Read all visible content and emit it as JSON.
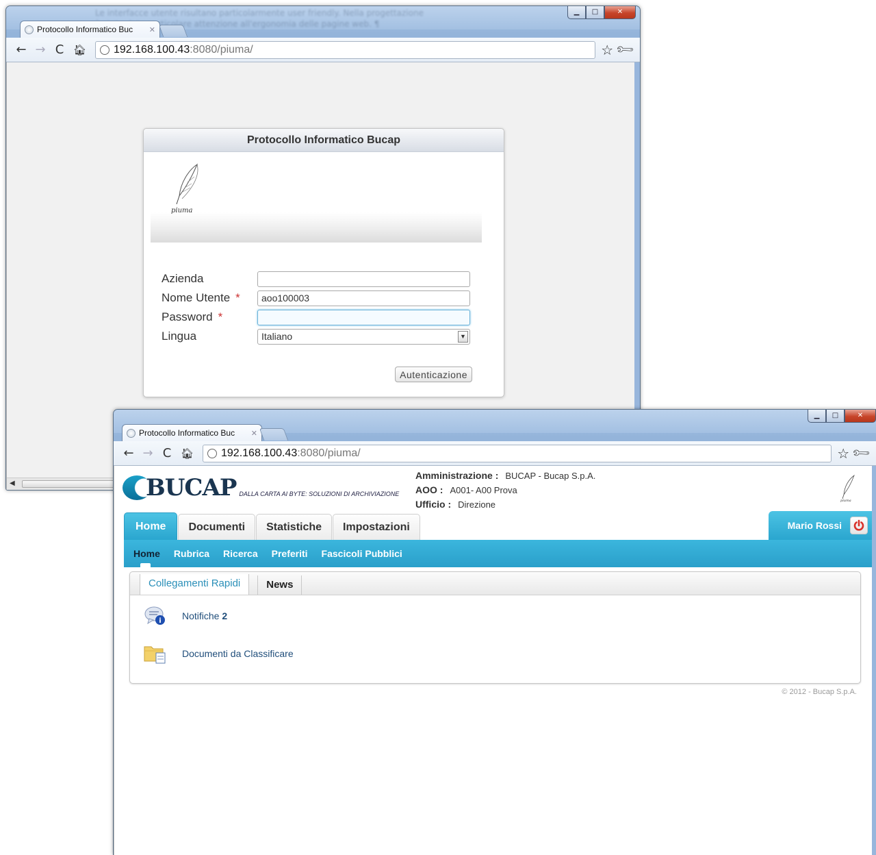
{
  "background_text": {
    "line1": "Le interfacce utente risultano particolarmente user friendly. Nella progettazione",
    "line2": "è stata data particolare attenzione all'ergonomia delle pagine web. ¶"
  },
  "login_window": {
    "tab_title": "Protocollo Informatico Buc",
    "url_host": "192.168.100.43",
    "url_path": ":8080/piuma/",
    "box_title": "Protocollo Informatico Bucap",
    "logo_text": "piuma",
    "fields": {
      "azienda_label": "Azienda",
      "azienda_value": "",
      "username_label": "Nome Utente",
      "username_value": "aoo100003",
      "password_label": "Password",
      "password_value": "",
      "lingua_label": "Lingua",
      "lingua_value": "Italiano",
      "required_mark": "*"
    },
    "submit_label": "Autenticazione"
  },
  "home_window": {
    "tab_title": "Protocollo Informatico Buc",
    "url_host": "192.168.100.43",
    "url_path": ":8080/piuma/",
    "logo_word": "BUCAP",
    "logo_tagline": "DALLA CARTA AI BYTE: SOLUZIONI DI ARCHIVIAZIONE",
    "org": {
      "amministrazione_label": "Amministrazione :",
      "amministrazione_value": "BUCAP - Bucap S.p.A.",
      "aoo_label": "AOO :",
      "aoo_value": "A001- A00 Prova",
      "ufficio_label": "Ufficio :",
      "ufficio_value": "Direzione"
    },
    "main_tabs": [
      "Home",
      "Documenti",
      "Statistiche",
      "Impostazioni"
    ],
    "user_name": "Mario Rossi",
    "sub_nav": [
      "Home",
      "Rubrica",
      "Ricerca",
      "Preferiti",
      "Fascicoli Pubblici"
    ],
    "panel_tabs": [
      "Collegamenti Rapidi",
      "News"
    ],
    "quick_links": {
      "notifiche_label": "Notifiche",
      "notifiche_count": "2",
      "documenti_label": "Documenti da Classificare"
    },
    "copyright": "© 2012 - Bucap S.p.A."
  },
  "colors": {
    "accent_blue": "#2aa6cf",
    "link_blue": "#1f4d7a",
    "required_red": "#cc3333",
    "power_red": "#d9322a"
  },
  "icons": [
    "globe-icon",
    "back-arrow-icon",
    "forward-arrow-icon",
    "reload-icon",
    "home-icon",
    "star-icon",
    "wrench-icon",
    "quill-icon",
    "power-icon",
    "notification-icon",
    "folder-document-icon",
    "dropdown-arrow-icon"
  ]
}
